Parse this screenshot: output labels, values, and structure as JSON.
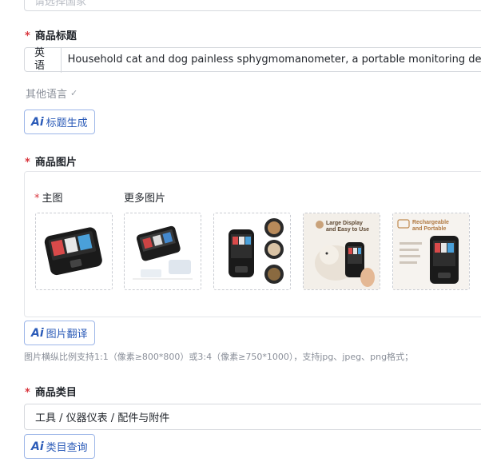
{
  "top_field": {
    "placeholder": "请选择国家"
  },
  "product_title": {
    "label": "商品标题",
    "required_mark": "*",
    "lang_prefix": "英语",
    "value": "Household cat and dog painless sphygmomanometer, a portable monitoring device"
  },
  "other_language": {
    "label": "其他语言"
  },
  "ai_title_button": {
    "ai_text": "Ai",
    "label": "标题生成"
  },
  "product_images": {
    "label": "商品图片",
    "required_mark": "*",
    "main_label": "主图",
    "more_label": "更多图片",
    "thumbnails": [
      {
        "icon": "device-main-image"
      },
      {
        "icon": "device-accessories-image"
      },
      {
        "icon": "device-pets-image"
      },
      {
        "icon": "device-dog-usage-image",
        "caption": "Large Display and Easy to Use"
      },
      {
        "icon": "device-rechargeable-image",
        "caption": "Rechargeable and Portable"
      }
    ]
  },
  "ai_image_translate_button": {
    "ai_text": "Ai",
    "label": "图片翻译"
  },
  "image_hint": "图片横纵比例支持1:1（像素≥800*800）或3:4（像素≥750*1000），支持jpg、jpeg、png格式；",
  "category": {
    "label": "商品类目",
    "required_mark": "*",
    "value": "工具 / 仪器仪表 / 配件与附件"
  },
  "ai_category_button": {
    "ai_text": "Ai",
    "label": "类目查询"
  },
  "colors": {
    "accent": "#2b5bb8",
    "required": "#d9363e",
    "border": "#d6d9de",
    "hint": "#8a8f99"
  }
}
